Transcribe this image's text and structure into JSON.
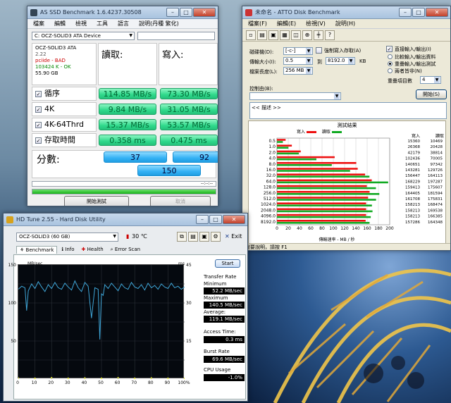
{
  "asssd": {
    "title": "AS SSD Benchmark 1.6.4237.30508",
    "menu": [
      "檔案",
      "編輯",
      "檢視",
      "工具",
      "語言",
      "說明(丹種 繁化)"
    ],
    "device_combo": "C: OCZ-SOLID3 ATA Device",
    "device_info": [
      "OCZ-SOLID3 ATA",
      "2.22",
      "pciide - BAD",
      "103424 K - OK",
      "55.90 GB"
    ],
    "read_header": "讀取:",
    "write_header": "寫入:",
    "rows": [
      {
        "label": "循序",
        "read": "114.85 MB/s",
        "write": "73.30 MB/s"
      },
      {
        "label": "4K",
        "read": "9.84 MB/s",
        "write": "31.05 MB/s"
      },
      {
        "label": "4K-64Thrd",
        "read": "15.37 MB/s",
        "write": "53.57 MB/s"
      },
      {
        "label": "存取時間",
        "read": "0.358 ms",
        "write": "0.475 ms"
      }
    ],
    "score_label": "分數:",
    "score_read": "37",
    "score_write": "92",
    "score_total": "150",
    "time_text": "--:--:--",
    "progress": 1.0,
    "start_button": "開始測試",
    "cancel_button": "取消"
  },
  "atto": {
    "title": "未命名 - ATTO Disk Benchmark",
    "menu": [
      "檔案(F)",
      "編輯(E)",
      "檢視(V)",
      "說明(H)"
    ],
    "drive_label": "磁碟機(D):",
    "drive_value": "[-c-]",
    "force_write_label": "強制寫入存取(A)",
    "transfer_label": "傳輸大小(I):",
    "transfer_from": "0.5",
    "to_label": "到",
    "transfer_to": "8192.0",
    "kb_label": "KB",
    "length_label": "檔案長度(L):",
    "length_value": "256 MB",
    "direct_io_label": "直接輸入/輸出(I)",
    "compare_io_label": "比較輸入/輸出資料",
    "overlap_io_label": "重疊輸入/輸出測試",
    "neither_label": "兩者皆非(N)",
    "queue_label": "重疊項目數",
    "queue_value": "4",
    "controlled_label": "控制由(B):",
    "desc_text": "<< 描述 >>",
    "start_button": "開始(S)",
    "results_label": "測試結果",
    "write_legend": "寫入",
    "read_legend": "讀取",
    "col_write": "寫入",
    "col_read": "讀取",
    "xaxis_label": "傳輸速率 - MB / 秒",
    "status": "需要說明，請按 F1"
  },
  "chart_data": [
    {
      "type": "bar",
      "title": "測試結果",
      "xlabel": "傳輸速率 - MB / 秒",
      "categories": [
        "0.5",
        "1.0",
        "2.0",
        "4.0",
        "8.0",
        "16.0",
        "32.0",
        "64.0",
        "128.0",
        "256.0",
        "512.0",
        "1024.0",
        "2048.0",
        "4096.0",
        "8192.0"
      ],
      "xlim": [
        0,
        200
      ],
      "x_ticks": [
        "0",
        "20",
        "40",
        "60",
        "80",
        "100",
        "120",
        "140",
        "160",
        "180",
        "200"
      ],
      "series": [
        {
          "name": "寫入",
          "color": "#ee1111",
          "values": [
            15.4,
            26.4,
            42.2,
            102.4,
            140.7,
            143.3,
            156.4,
            168.2,
            159.4,
            164.4,
            161.7,
            158.2,
            158.2,
            158.2,
            157.3
          ],
          "labels": [
            "15360",
            "26368",
            "42179",
            "102436",
            "140651",
            "143281",
            "156447",
            "168229",
            "159413",
            "164405",
            "161708",
            "158213",
            "158213",
            "158213",
            "157286"
          ]
        },
        {
          "name": "讀取",
          "color": "#11aa22",
          "values": [
            10.5,
            20.4,
            38.8,
            70.0,
            97.3,
            129.7,
            164.1,
            197.3,
            175.6,
            181.6,
            175.8,
            168.5,
            169.5,
            166.4,
            164.3
          ],
          "labels": [
            "10469",
            "20428",
            "38814",
            "70005",
            "97342",
            "129726",
            "164113",
            "197287",
            "175607",
            "181594",
            "175831",
            "168474",
            "169538",
            "166385",
            "164348"
          ]
        }
      ]
    },
    {
      "type": "line",
      "title": "",
      "ylabel": "MB/sec",
      "y2label": "ms",
      "xlabel": "",
      "ylim": [
        0,
        150
      ],
      "y2lim": [
        0,
        45
      ],
      "y_ticks": [
        "150",
        "100",
        "50"
      ],
      "y2_ticks": [
        "45",
        "30",
        "15"
      ],
      "x_ticks": [
        "0",
        "10",
        "20",
        "30",
        "40",
        "50",
        "60",
        "70",
        "80",
        "90",
        "100%"
      ],
      "series": [
        {
          "name": "Transfer Rate",
          "color": "#3fa6d8",
          "x": [
            0,
            2,
            4,
            5,
            6,
            8,
            10,
            12,
            14,
            16,
            18,
            20,
            22,
            24,
            26,
            28,
            30,
            32,
            34,
            36,
            38,
            40,
            42,
            44,
            46,
            48,
            49,
            50,
            51,
            52,
            54,
            56,
            58,
            60,
            62,
            64,
            66,
            68,
            70,
            72,
            74,
            76,
            78,
            80,
            82,
            84,
            86,
            88,
            90,
            92,
            94,
            96,
            98,
            100
          ],
          "values": [
            118,
            122,
            120,
            90,
            116,
            125,
            119,
            128,
            121,
            115,
            124,
            119,
            127,
            120,
            118,
            126,
            121,
            117,
            129,
            120,
            115,
            127,
            122,
            80,
            120,
            118,
            52,
            112,
            110,
            124,
            119,
            126,
            121,
            116,
            125,
            120,
            118,
            127,
            121,
            119,
            124,
            117,
            126,
            120,
            123,
            118,
            125,
            121,
            119,
            126,
            120,
            122,
            118,
            121
          ]
        },
        {
          "name": "Access Time",
          "color": "#e8e83a",
          "x": [
            0,
            10,
            20,
            30,
            40,
            50,
            60,
            70,
            80,
            90,
            100
          ],
          "values": [
            0.4,
            0.3,
            0.5,
            0.3,
            0.4,
            0.3,
            0.5,
            0.3,
            0.4,
            0.3,
            0.3
          ]
        }
      ]
    }
  ],
  "hdtune": {
    "title": "HD Tune 2.55 - Hard Disk Utility",
    "drive_combo": "OCZ-SOLID3 (60 GB)",
    "temp": "30 ℃",
    "exit_label": "Exit",
    "tabs": [
      "Benchmark",
      "Info",
      "Health",
      "Error Scan"
    ],
    "start_button": "Start",
    "transfer_rate_label": "Transfer Rate",
    "minimum_label": "Minimum",
    "minimum_value": "52.2 MB/sec",
    "maximum_label": "Maximum",
    "maximum_value": "140.5 MB/sec",
    "average_label": "Average:",
    "average_value": "119.1 MB/sec",
    "access_time_label": "Access Time:",
    "access_time_value": "0.3 ms",
    "burst_rate_label": "Burst Rate",
    "burst_rate_value": "69.6 MB/sec",
    "cpu_usage_label": "CPU Usage",
    "cpu_usage_value": "-1.0%"
  }
}
